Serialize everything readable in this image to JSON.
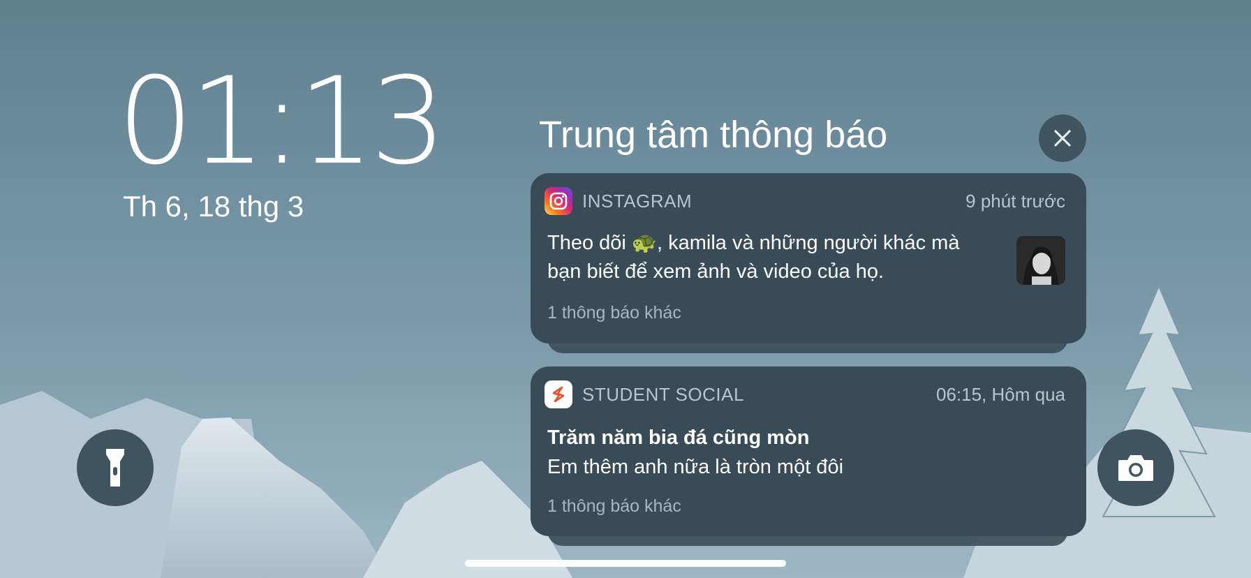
{
  "lock_screen": {
    "time": "01:13",
    "date": "Th 6, 18 thg 3"
  },
  "notification_center": {
    "title": "Trung tâm thông báo",
    "close_icon": "close-icon"
  },
  "notifications": [
    {
      "app": "INSTAGRAM",
      "icon": "instagram-icon",
      "time": "9 phút trước",
      "line1": "Theo dõi 🐢, kamila và những người khác mà",
      "line2": "bạn biết để xem ảnh và video của họ.",
      "more": "1 thông báo khác"
    },
    {
      "app": "STUDENT SOCIAL",
      "icon": "student-social-icon",
      "time": "06:15, Hôm qua",
      "title": "Trăm năm bia đá cũng mòn",
      "body": "Em thêm anh nữa là tròn một đôi",
      "more": "1 thông báo khác"
    }
  ],
  "controls": {
    "flashlight": "flashlight-icon",
    "camera": "camera-icon"
  },
  "colors": {
    "card": "#384b56",
    "secondary_text": "#b9c6cd",
    "instagram_gradient": [
      "#feda75",
      "#fa7e1e",
      "#d62976",
      "#962fbf",
      "#4f5bd5"
    ],
    "student_social_accent": "#e8532f"
  }
}
